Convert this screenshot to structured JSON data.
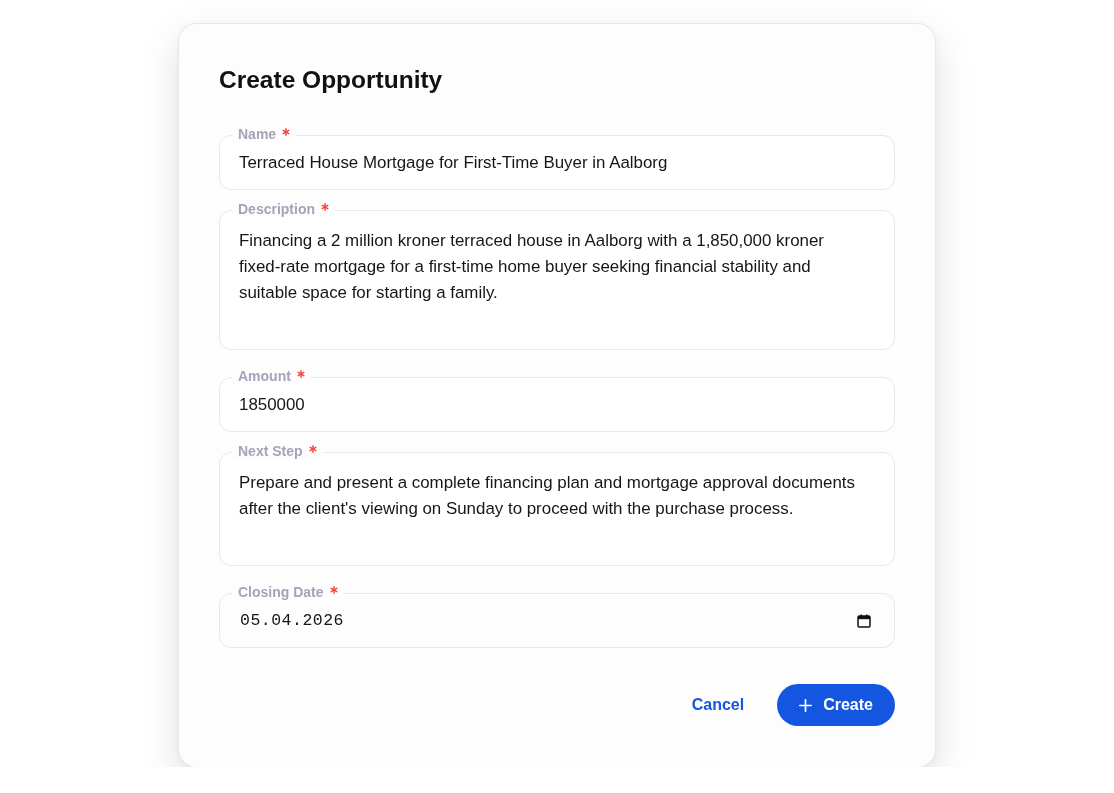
{
  "dialog": {
    "title": "Create Opportunity",
    "fields": [
      {
        "kind": "text",
        "label": "Name",
        "required": true,
        "value": "Terraced House Mortgage for First-Time Buyer in Aalborg"
      },
      {
        "kind": "multiline",
        "label": "Description",
        "required": true,
        "value": "Financing a 2 million kroner terraced house in Aalborg with a 1,850,000 kroner fixed-rate mortgage for a first-time home buyer seeking financial stability and suitable space for starting a family."
      },
      {
        "kind": "text",
        "label": "Amount",
        "required": true,
        "value": "1850000"
      },
      {
        "kind": "multiline",
        "label": "Next Step",
        "required": true,
        "value": "Prepare and present a complete financing plan and mortgage approval documents after the client's viewing on Sunday to proceed with the purchase process."
      },
      {
        "kind": "date",
        "label": "Closing Date",
        "required": true,
        "value": "05.04.2026"
      }
    ],
    "actions": [
      {
        "kind": "link",
        "label": "Cancel"
      },
      {
        "kind": "primary",
        "label": "Create"
      }
    ]
  }
}
